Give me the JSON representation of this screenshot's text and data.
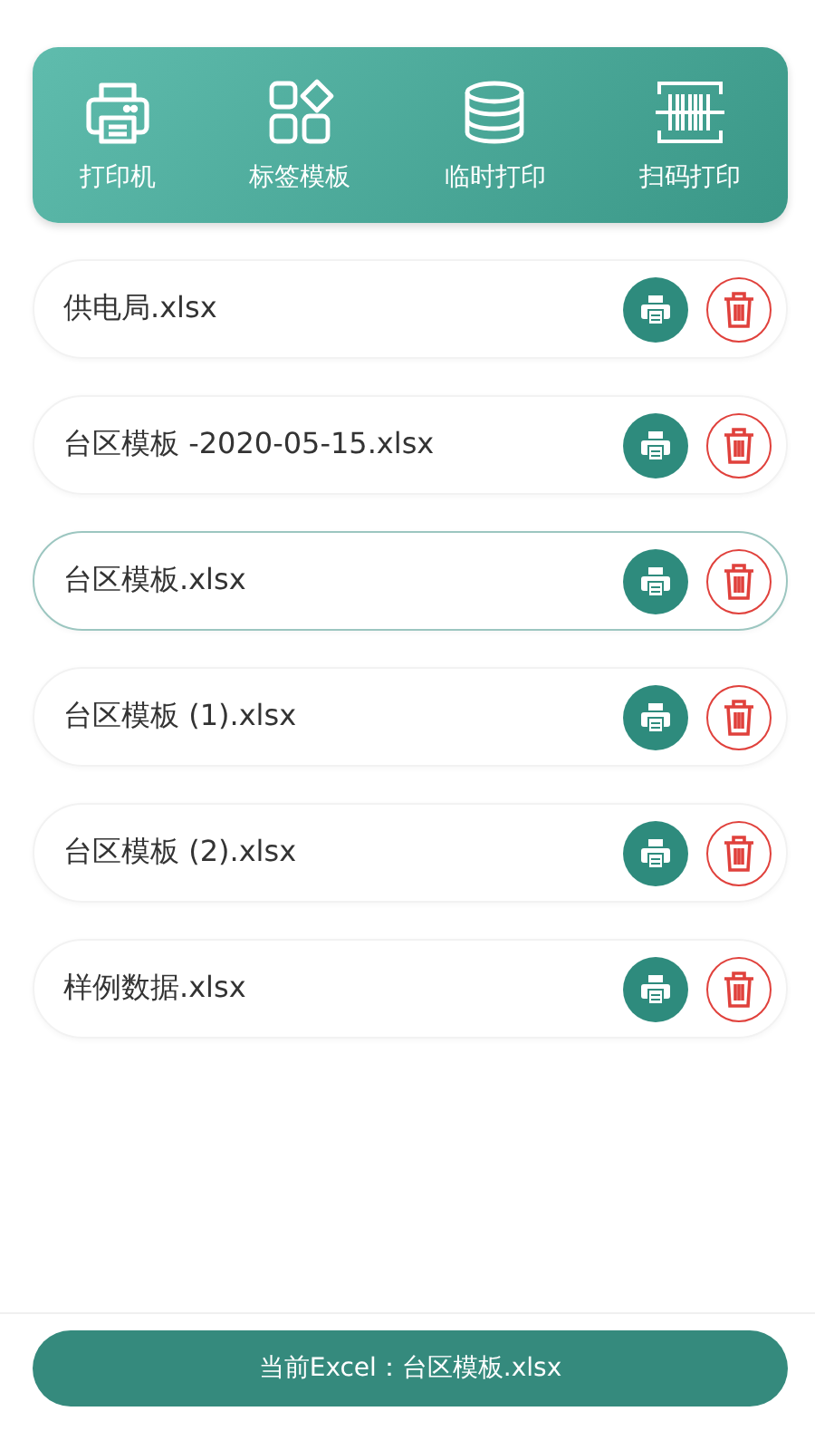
{
  "toolbar": [
    {
      "kind": "printer",
      "label": "打印机"
    },
    {
      "kind": "templates",
      "label": "标签模板"
    },
    {
      "kind": "database",
      "label": "临时打印"
    },
    {
      "kind": "barcode",
      "label": "扫码打印"
    }
  ],
  "files": [
    {
      "name": "供电局.xlsx",
      "selected": false
    },
    {
      "name": "台区模板 -2020-05-15.xlsx",
      "selected": false
    },
    {
      "name": "台区模板.xlsx",
      "selected": true
    },
    {
      "name": "台区模板 (1).xlsx",
      "selected": false
    },
    {
      "name": "台区模板 (2).xlsx",
      "selected": false
    },
    {
      "name": "样例数据.xlsx",
      "selected": false
    }
  ],
  "current_button": "当前Excel：台区模板.xlsx"
}
